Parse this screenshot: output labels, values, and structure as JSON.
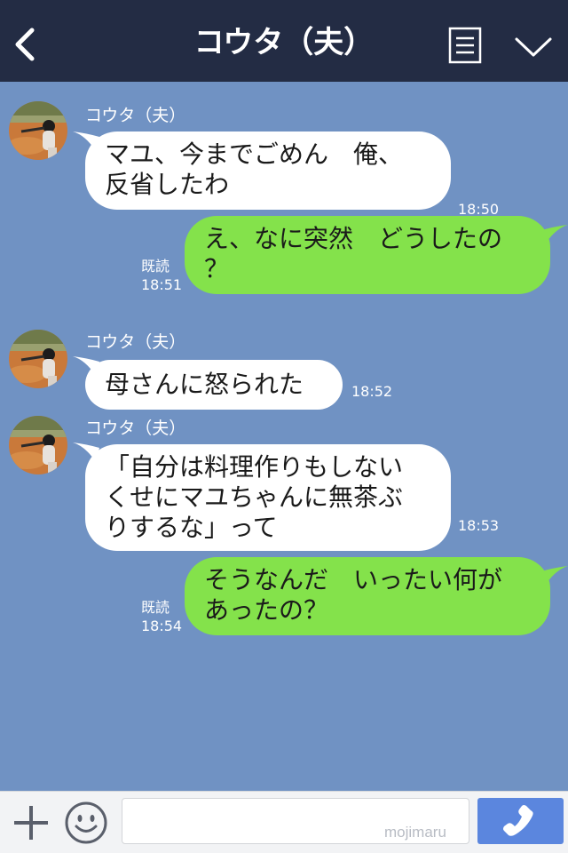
{
  "header": {
    "title": "コウタ（夫）",
    "back_icon": "chevron-left-icon",
    "menu_icon": "list-icon",
    "dropdown_icon": "chevron-down-icon",
    "background": "#232c44"
  },
  "chat": {
    "background": "#7092c3",
    "incoming_bubble_color": "#ffffff",
    "outgoing_bubble_color": "#84e24b",
    "messages": [
      {
        "direction": "incoming",
        "sender": "コウタ（夫）",
        "text": "マユ、今までごめん　俺、\n反省したわ",
        "time": "18:50"
      },
      {
        "direction": "outgoing",
        "read": "既読",
        "text": "え、なに突然　どうしたの\n？",
        "time": "18:51"
      },
      {
        "direction": "incoming",
        "sender": "コウタ（夫）",
        "text": "母さんに怒られた",
        "time": "18:52"
      },
      {
        "direction": "incoming",
        "sender": "コウタ（夫）",
        "text": "「自分は料理作りもしない\nくせにマユちゃんに無茶ぶ\nりするな」って",
        "time": "18:53"
      },
      {
        "direction": "outgoing",
        "read": "既読",
        "text": "そうなんだ　いったい何が\nあったの？",
        "time": "18:54"
      }
    ]
  },
  "input_bar": {
    "plus_icon": "plus-icon",
    "emoji_icon": "smiley-icon",
    "placeholder": "",
    "watermark": "mojimaru",
    "call_icon": "phone-icon",
    "call_button_color": "#5b86de"
  }
}
